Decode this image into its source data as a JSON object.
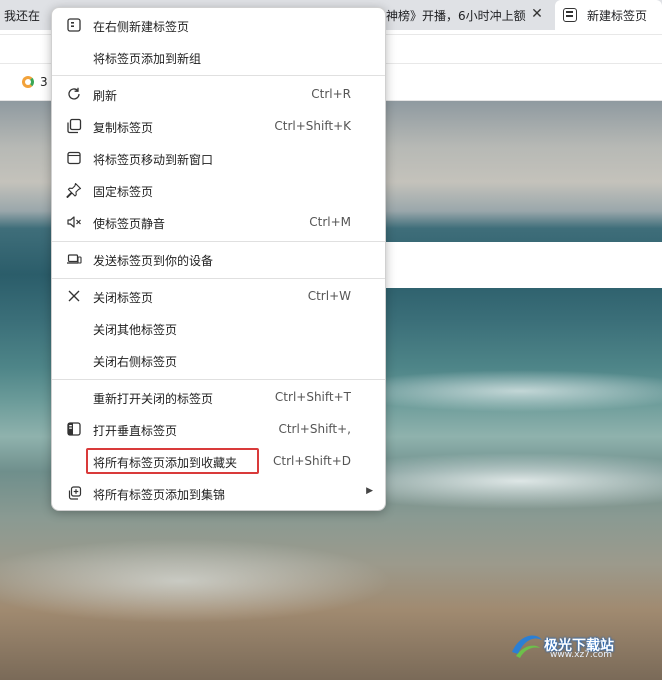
{
  "tabs": {
    "left_title": "我还在",
    "middle_title": "神榜》开播，6小时冲上额",
    "active_title": "新建标签页",
    "close_glyph": "✕"
  },
  "favorites": {
    "item_label": "3"
  },
  "context_menu": {
    "items": [
      {
        "label": "在右侧新建标签页",
        "shortcut": ""
      },
      {
        "label": "将标签页添加到新组",
        "shortcut": ""
      },
      {
        "label": "刷新",
        "shortcut": "Ctrl+R"
      },
      {
        "label": "复制标签页",
        "shortcut": "Ctrl+Shift+K"
      },
      {
        "label": "将标签页移动到新窗口",
        "shortcut": ""
      },
      {
        "label": "固定标签页",
        "shortcut": ""
      },
      {
        "label": "使标签页静音",
        "shortcut": "Ctrl+M"
      },
      {
        "label": "发送标签页到你的设备",
        "shortcut": ""
      },
      {
        "label": "关闭标签页",
        "shortcut": "Ctrl+W"
      },
      {
        "label": "关闭其他标签页",
        "shortcut": ""
      },
      {
        "label": "关闭右侧标签页",
        "shortcut": ""
      },
      {
        "label": "重新打开关闭的标签页",
        "shortcut": "Ctrl+Shift+T"
      },
      {
        "label": "打开垂直标签页",
        "shortcut": "Ctrl+Shift+,"
      },
      {
        "label": "将所有标签页添加到收藏夹",
        "shortcut": "Ctrl+Shift+D"
      },
      {
        "label": "将所有标签页添加到集锦",
        "shortcut": ""
      }
    ],
    "submenu_arrow": "▶",
    "highlight_color": "#d93a3a"
  },
  "watermark": {
    "text": "极光下载站",
    "sub": "www.xz7.com"
  }
}
